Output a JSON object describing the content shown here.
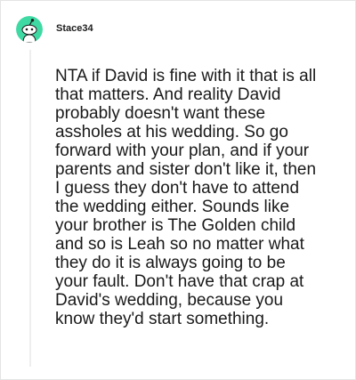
{
  "comment": {
    "username": "Stace34",
    "avatar_icon": "snoo-avatar-icon",
    "accent_color": "#3fd9a4",
    "body": "NTA if David is fine with it that is all that matters. And reality David probably doesn't want these assholes at his wedding. So go forward with your plan, and if your parents and sister don't like it, then I guess they don't have to attend the wedding either. Sounds like your brother is The Golden child and so is Leah so no matter what they do it is always going to be your fault. Don't have that crap at David's wedding, because you know they'd start something."
  }
}
